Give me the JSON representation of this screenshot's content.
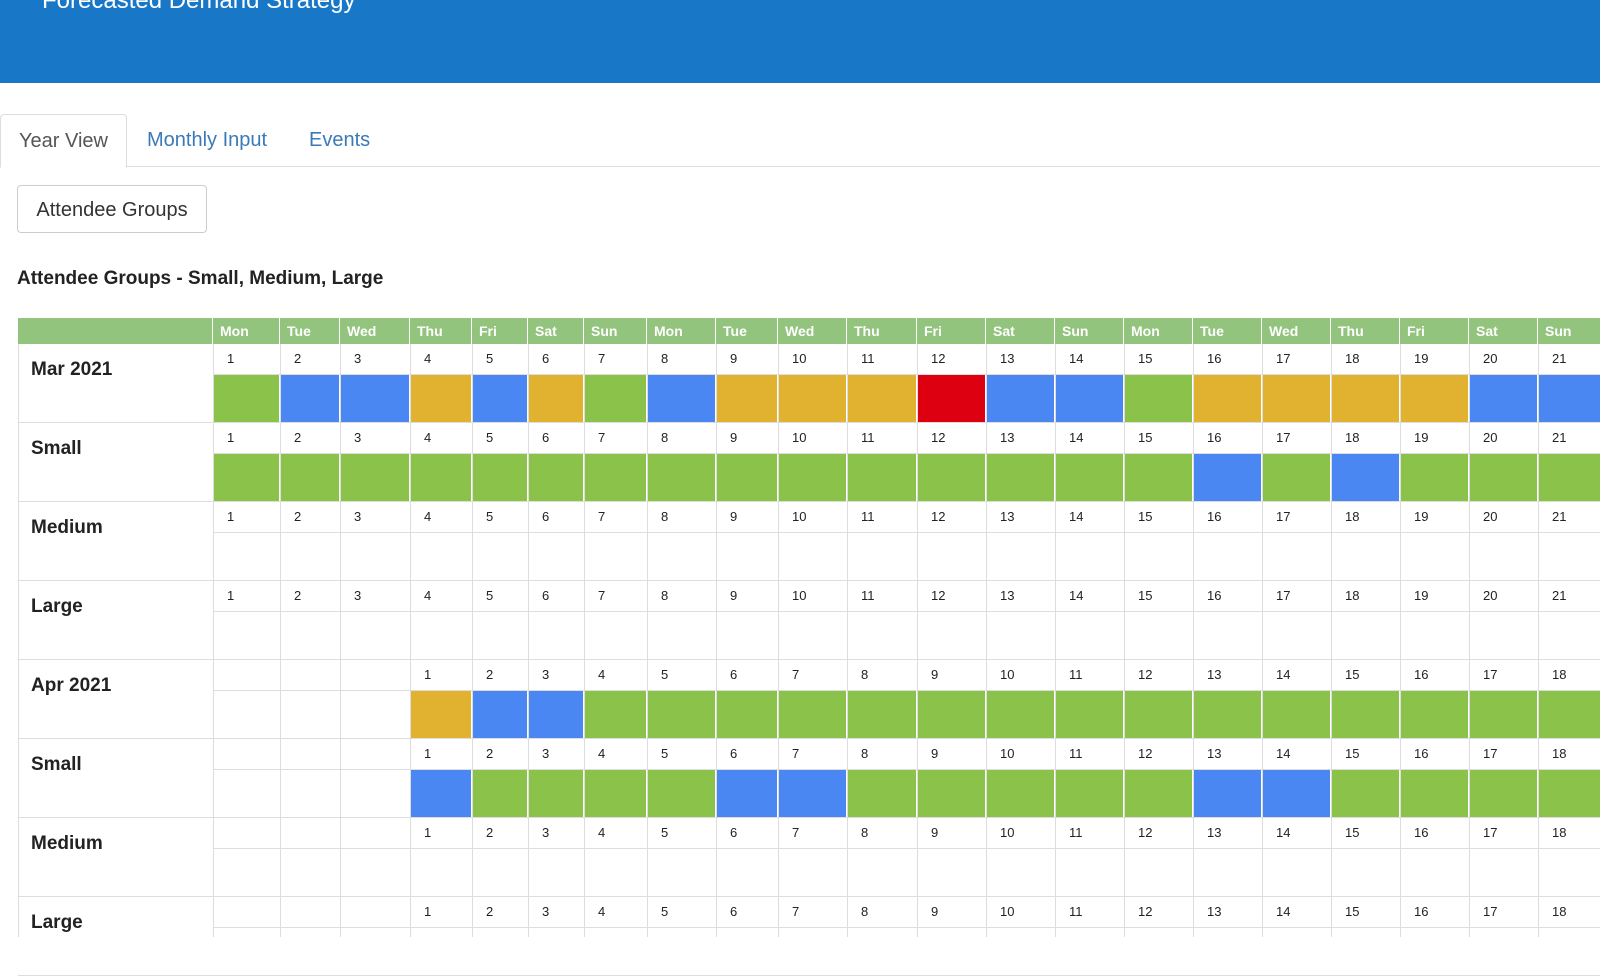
{
  "header": {
    "title": "Forecasted Demand Strategy"
  },
  "tabs": [
    {
      "label": "Year View",
      "active": true
    },
    {
      "label": "Monthly Input",
      "active": false
    },
    {
      "label": "Events",
      "active": false
    }
  ],
  "attendee_button": {
    "label": "Attendee Groups"
  },
  "section_title": "Attendee Groups - Small, Medium, Large",
  "colors": {
    "green": "#8bc34a",
    "blue": "#4b87f2",
    "yellow": "#e0b22f",
    "red": "#dd0010",
    "header_green": "#93c47d"
  },
  "weekdays": [
    "Mon",
    "Tue",
    "Wed",
    "Thu",
    "Fri",
    "Sat",
    "Sun",
    "Mon",
    "Tue",
    "Wed",
    "Thu",
    "Fri",
    "Sat",
    "Sun",
    "Mon",
    "Tue",
    "Wed",
    "Thu",
    "Fri",
    "Sat",
    "Sun"
  ],
  "rows": [
    {
      "label": "Mar 2021",
      "days": [
        "1",
        "2",
        "3",
        "4",
        "5",
        "6",
        "7",
        "8",
        "9",
        "10",
        "11",
        "12",
        "13",
        "14",
        "15",
        "16",
        "17",
        "18",
        "19",
        "20",
        "21"
      ],
      "status": [
        "green",
        "blue",
        "blue",
        "yellow",
        "blue",
        "yellow",
        "green",
        "blue",
        "yellow",
        "yellow",
        "yellow",
        "red",
        "blue",
        "blue",
        "green",
        "yellow",
        "yellow",
        "yellow",
        "yellow",
        "blue",
        "blue"
      ]
    },
    {
      "label": "Small",
      "days": [
        "1",
        "2",
        "3",
        "4",
        "5",
        "6",
        "7",
        "8",
        "9",
        "10",
        "11",
        "12",
        "13",
        "14",
        "15",
        "16",
        "17",
        "18",
        "19",
        "20",
        "21"
      ],
      "status": [
        "green",
        "green",
        "green",
        "green",
        "green",
        "green",
        "green",
        "green",
        "green",
        "green",
        "green",
        "green",
        "green",
        "green",
        "green",
        "blue",
        "green",
        "blue",
        "green",
        "green",
        "green"
      ]
    },
    {
      "label": "Medium",
      "days": [
        "1",
        "2",
        "3",
        "4",
        "5",
        "6",
        "7",
        "8",
        "9",
        "10",
        "11",
        "12",
        "13",
        "14",
        "15",
        "16",
        "17",
        "18",
        "19",
        "20",
        "21"
      ],
      "status": [
        "",
        "",
        "",
        "",
        "",
        "",
        "",
        "",
        "",
        "",
        "",
        "",
        "",
        "",
        "",
        "",
        "",
        "",
        "",
        "",
        ""
      ]
    },
    {
      "label": "Large",
      "days": [
        "1",
        "2",
        "3",
        "4",
        "5",
        "6",
        "7",
        "8",
        "9",
        "10",
        "11",
        "12",
        "13",
        "14",
        "15",
        "16",
        "17",
        "18",
        "19",
        "20",
        "21"
      ],
      "status": [
        "",
        "",
        "",
        "",
        "",
        "",
        "",
        "",
        "",
        "",
        "",
        "",
        "",
        "",
        "",
        "",
        "",
        "",
        "",
        "",
        ""
      ]
    },
    {
      "label": "Apr 2021",
      "days": [
        "",
        "",
        "",
        "1",
        "2",
        "3",
        "4",
        "5",
        "6",
        "7",
        "8",
        "9",
        "10",
        "11",
        "12",
        "13",
        "14",
        "15",
        "16",
        "17",
        "18"
      ],
      "status": [
        "",
        "",
        "",
        "yellow",
        "blue",
        "blue",
        "green",
        "green",
        "green",
        "green",
        "green",
        "green",
        "green",
        "green",
        "green",
        "green",
        "green",
        "green",
        "green",
        "green",
        "green"
      ]
    },
    {
      "label": "Small",
      "days": [
        "",
        "",
        "",
        "1",
        "2",
        "3",
        "4",
        "5",
        "6",
        "7",
        "8",
        "9",
        "10",
        "11",
        "12",
        "13",
        "14",
        "15",
        "16",
        "17",
        "18"
      ],
      "status": [
        "",
        "",
        "",
        "blue",
        "green",
        "green",
        "green",
        "green",
        "blue",
        "blue",
        "green",
        "green",
        "green",
        "green",
        "green",
        "blue",
        "blue",
        "green",
        "green",
        "green",
        "green"
      ]
    },
    {
      "label": "Medium",
      "days": [
        "",
        "",
        "",
        "1",
        "2",
        "3",
        "4",
        "5",
        "6",
        "7",
        "8",
        "9",
        "10",
        "11",
        "12",
        "13",
        "14",
        "15",
        "16",
        "17",
        "18"
      ],
      "status": [
        "",
        "",
        "",
        "",
        "",
        "",
        "",
        "",
        "",
        "",
        "",
        "",
        "",
        "",
        "",
        "",
        "",
        "",
        "",
        "",
        ""
      ]
    },
    {
      "label": "Large",
      "days": [
        "",
        "",
        "",
        "1",
        "2",
        "3",
        "4",
        "5",
        "6",
        "7",
        "8",
        "9",
        "10",
        "11",
        "12",
        "13",
        "14",
        "15",
        "16",
        "17",
        "18"
      ],
      "status": [
        "",
        "",
        "",
        "",
        "",
        "",
        "",
        "",
        "",
        "",
        "",
        "",
        "",
        "",
        "",
        "",
        "",
        "",
        "",
        "",
        ""
      ]
    }
  ]
}
